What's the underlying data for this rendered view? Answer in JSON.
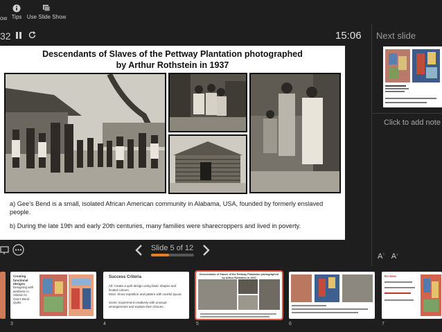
{
  "toolbar": {
    "items": [
      {
        "label": "ow"
      },
      {
        "label": "Tips"
      },
      {
        "label": "Use Slide Show"
      }
    ]
  },
  "timer": {
    "elapsed": "32",
    "clock": "15:06"
  },
  "next_slide": {
    "label": "Next slide",
    "notes_placeholder": "Click to add note"
  },
  "current_slide": {
    "title_line1": "Descendants of Slaves of the Pettway Plantation photographed",
    "title_line2": "by Arthur Rothstein in 1937",
    "bullet_a": "a) Gee’s Bend is a small, isolated African American community in Alabama, USA, founded by formerly enslaved people.",
    "bullet_b": "b) During the late 19th and early 20th centuries, many families were sharecroppers and lived in poverty."
  },
  "navigation": {
    "counter": "Slide 5 of 12",
    "progress": 0.42
  },
  "filmstrip": {
    "slides": [
      {
        "num": "3",
        "title": "Creating functional designs",
        "body": "Designing with aesthetic in relation to Gee's Bend Quilts"
      },
      {
        "num": "4",
        "title": "Success Criteria",
        "all": "All: Create a quilt design using basic shapes and limited colours.",
        "most": "Most: Show repetition and pattern with careful layout.",
        "some": "Some: Experiment creatively with unusual arrangements and explain their choices."
      },
      {
        "num": "5",
        "title": "Descendants of Slaves of the Pettway Plantation photographed by Arthur Rothstein in 1937"
      },
      {
        "num": "6",
        "title": ""
      },
      {
        "num": "7",
        "title": "Do Now"
      }
    ]
  },
  "colors": {
    "accent": "#e67e22",
    "active_thumb_border": "#e0553a",
    "background": "#1e1e1e"
  }
}
